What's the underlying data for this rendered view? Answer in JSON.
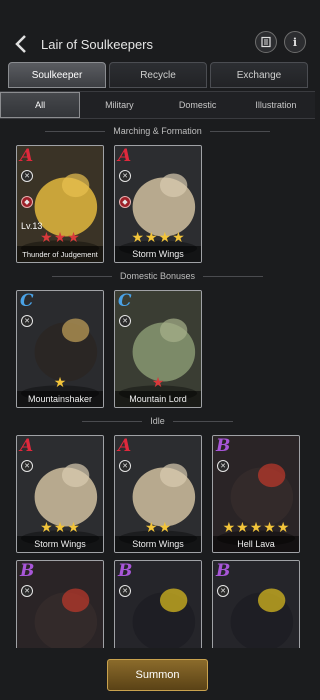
{
  "header": {
    "title": "Lair of Soulkeepers",
    "back_icon": "chevron-left-icon",
    "book_icon": "book-icon",
    "info_label": "i"
  },
  "tabs": [
    {
      "label": "Soulkeeper",
      "active": true
    },
    {
      "label": "Recycle",
      "active": false
    },
    {
      "label": "Exchange",
      "active": false
    }
  ],
  "subtabs": [
    {
      "label": "All",
      "active": true
    },
    {
      "label": "Military",
      "active": false
    },
    {
      "label": "Domestic",
      "active": false
    },
    {
      "label": "Illustration",
      "active": false
    }
  ],
  "sections": {
    "marching": "Marching & Formation",
    "domestic": "Domestic Bonuses",
    "idle": "Idle"
  },
  "cards": [
    {
      "name": "Thunder of Judgement",
      "grade": "A",
      "level": "Lv.13",
      "stars_gold": 0,
      "stars_red": 3,
      "section": "marching"
    },
    {
      "name": "Storm Wings",
      "grade": "A",
      "level": "",
      "stars_gold": 4,
      "stars_red": 0,
      "section": "marching"
    },
    {
      "name": "Mountainshaker",
      "grade": "C",
      "level": "",
      "stars_gold": 1,
      "stars_red": 0,
      "section": "domestic"
    },
    {
      "name": "Mountain Lord",
      "grade": "C",
      "level": "",
      "stars_gold": 0,
      "stars_red": 1,
      "section": "domestic"
    },
    {
      "name": "Storm Wings",
      "grade": "A",
      "level": "",
      "stars_gold": 3,
      "stars_red": 0,
      "section": "idle"
    },
    {
      "name": "Storm Wings",
      "grade": "A",
      "level": "",
      "stars_gold": 2,
      "stars_red": 0,
      "section": "idle"
    },
    {
      "name": "Hell Lava",
      "grade": "B",
      "level": "",
      "stars_gold": 5,
      "stars_red": 0,
      "section": "idle"
    },
    {
      "name": "",
      "grade": "B",
      "level": "",
      "stars_gold": 0,
      "stars_red": 0,
      "section": "idle"
    },
    {
      "name": "",
      "grade": "B",
      "level": "",
      "stars_gold": 0,
      "stars_red": 0,
      "section": "idle"
    },
    {
      "name": "",
      "grade": "B",
      "level": "",
      "stars_gold": 0,
      "stars_red": 0,
      "section": "idle"
    }
  ],
  "footer": {
    "summon_label": "Summon"
  },
  "colors": {
    "grade_A": "#e0283c",
    "grade_B": "#a856d8",
    "grade_C": "#4aa2e6",
    "star_gold": "#f2c43a",
    "star_red": "#d9393b",
    "summon_gold": "#c9a24e"
  }
}
